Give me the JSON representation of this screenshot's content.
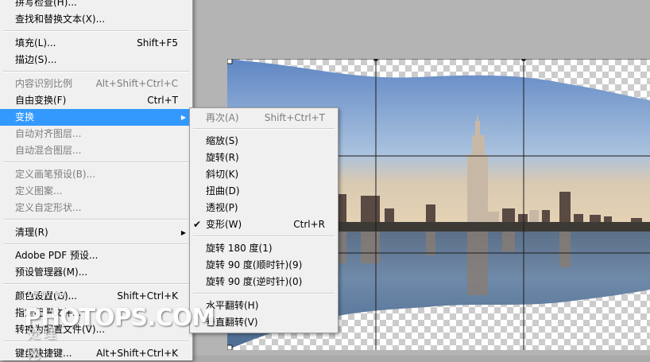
{
  "main_menu": {
    "items_top": [
      {
        "label": "拼写检查(H)...",
        "shortcut": "",
        "state": "normal"
      },
      {
        "label": "查找和替换文本(X)...",
        "shortcut": "",
        "state": "normal"
      },
      {
        "label": "填充(L)...",
        "shortcut": "Shift+F5",
        "state": "normal"
      },
      {
        "label": "描边(S)...",
        "shortcut": "",
        "state": "normal"
      },
      {
        "label": "内容识别比例",
        "shortcut": "Alt+Shift+Ctrl+C",
        "state": "disabled"
      },
      {
        "label": "自由变换(F)",
        "shortcut": "Ctrl+T",
        "state": "normal"
      },
      {
        "label": "变换",
        "shortcut": "",
        "state": "selected"
      },
      {
        "label": "自动对齐图层...",
        "shortcut": "",
        "state": "disabled"
      },
      {
        "label": "自动混合图层...",
        "shortcut": "",
        "state": "disabled"
      },
      {
        "label": "定义画笔预设(B)...",
        "shortcut": "",
        "state": "disabled"
      },
      {
        "label": "定义图案...",
        "shortcut": "",
        "state": "disabled"
      },
      {
        "label": "定义自定形状...",
        "shortcut": "",
        "state": "disabled"
      },
      {
        "label": "清理(R)",
        "shortcut": "",
        "state": "normal"
      },
      {
        "label": "Adobe PDF 预设...",
        "shortcut": "",
        "state": "normal"
      },
      {
        "label": "预设管理器(M)...",
        "shortcut": "",
        "state": "normal"
      },
      {
        "label": "颜色设置(G)...",
        "shortcut": "Shift+Ctrl+K",
        "state": "normal"
      },
      {
        "label": "指定配置文件...",
        "shortcut": "",
        "state": "normal"
      },
      {
        "label": "转换为配置文件(V)...",
        "shortcut": "",
        "state": "normal"
      },
      {
        "label": "键盘快捷键...",
        "shortcut": "Alt+Shift+Ctrl+K",
        "state": "normal"
      }
    ]
  },
  "sub_menu": {
    "items": [
      {
        "label": "再次(A)",
        "shortcut": "Shift+Ctrl+T",
        "state": "disabled",
        "checked": ""
      },
      {
        "label": "缩放(S)",
        "shortcut": "",
        "state": "normal",
        "checked": ""
      },
      {
        "label": "旋转(R)",
        "shortcut": "",
        "state": "normal",
        "checked": ""
      },
      {
        "label": "斜切(K)",
        "shortcut": "",
        "state": "normal",
        "checked": ""
      },
      {
        "label": "扭曲(D)",
        "shortcut": "",
        "state": "normal",
        "checked": ""
      },
      {
        "label": "透视(P)",
        "shortcut": "",
        "state": "normal",
        "checked": ""
      },
      {
        "label": "变形(W)",
        "shortcut": "Ctrl+R",
        "state": "normal",
        "checked": "✔"
      },
      {
        "label": "旋转 180 度(1)",
        "shortcut": "",
        "state": "normal",
        "checked": ""
      },
      {
        "label": "旋转 90 度(顺时针)(9)",
        "shortcut": "",
        "state": "normal",
        "checked": ""
      },
      {
        "label": "旋转 90 度(逆时针)(0)",
        "shortcut": "",
        "state": "normal",
        "checked": ""
      },
      {
        "label": "水平翻转(H)",
        "shortcut": "",
        "state": "normal",
        "checked": ""
      },
      {
        "label": "垂直翻转(V)",
        "shortcut": "",
        "state": "normal",
        "checked": ""
      }
    ]
  },
  "submenu_arrow": "▶",
  "watermark": {
    "line1": "www. 照片处理网",
    "line2": "PHOTOPS.COM"
  },
  "colors": {
    "menu_bg": "#f0f0f0",
    "highlight": "#3399ff",
    "disabled_text": "#7c7c7c",
    "canvas_bg": "#b4b4b4"
  }
}
